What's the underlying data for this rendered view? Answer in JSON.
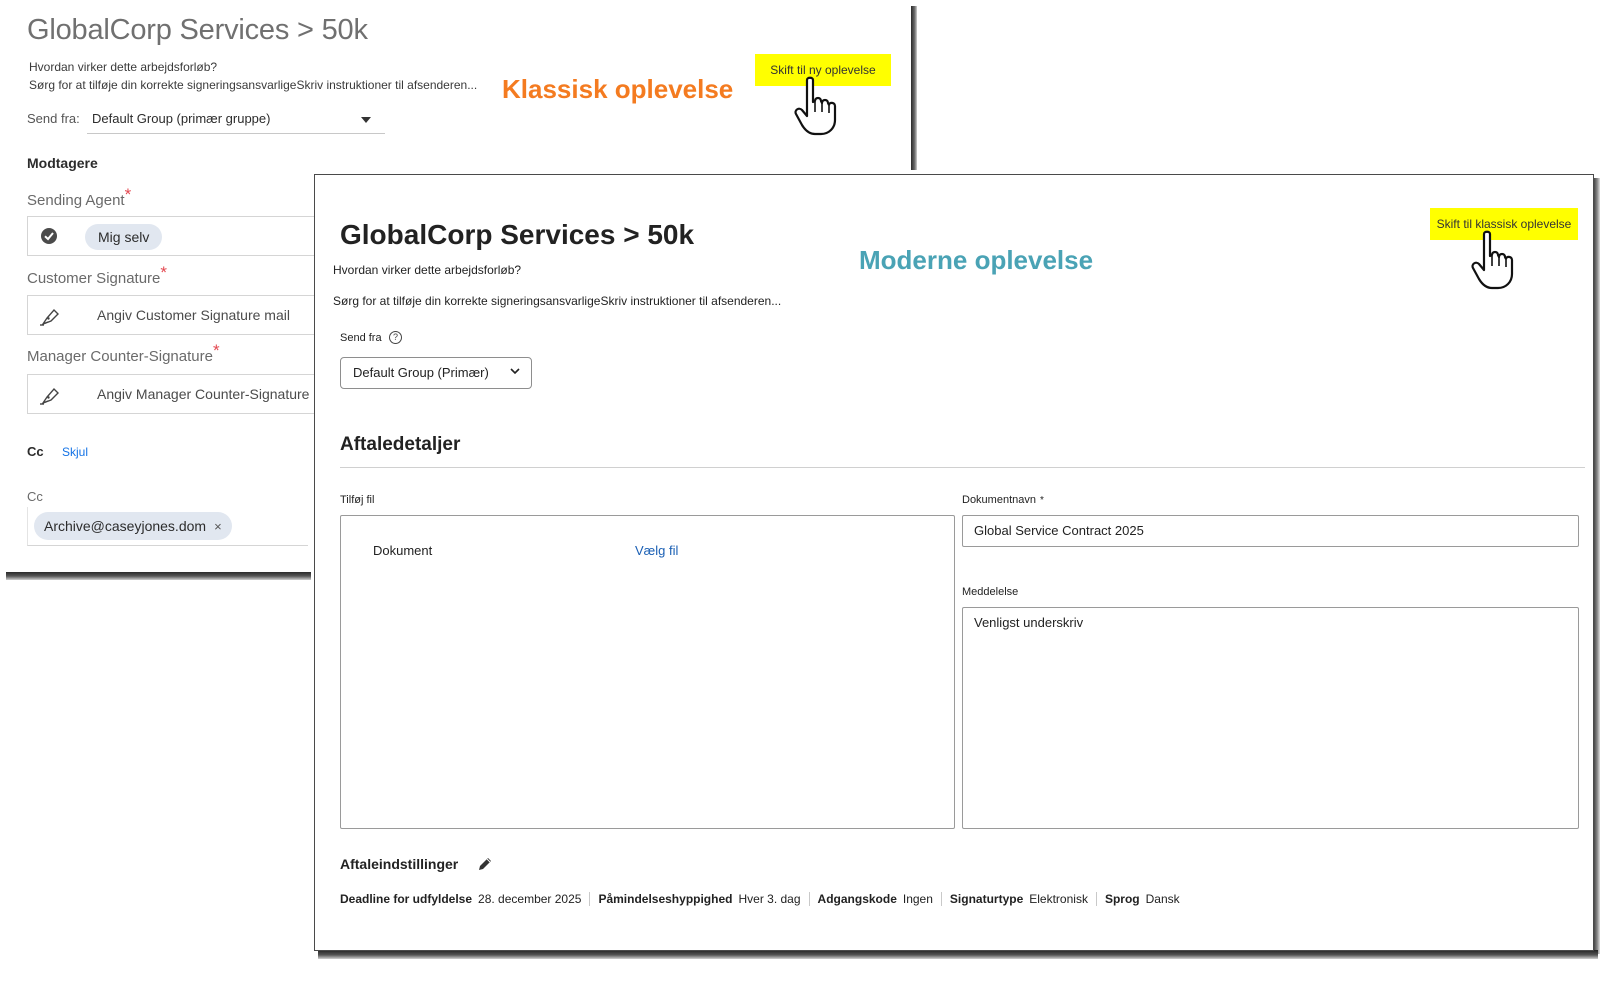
{
  "classic": {
    "title": "GlobalCorp Services > 50k",
    "how_it_works": "Hvordan virker dette arbejdsforløb?",
    "instructions": "Sørg for at tilføje din korrekte signeringsansvarligeSkriv instruktioner til afsenderen...",
    "send_from_label": "Send fra:",
    "send_from_value": "Default Group (primær gruppe)",
    "recipients_heading": "Modtagere",
    "fields": [
      {
        "label": "Sending Agent",
        "required_mark": "*",
        "value": "Mig selv",
        "icon": "check-circle-icon"
      },
      {
        "label": "Customer Signature",
        "required_mark": "*",
        "placeholder": "Angiv Customer Signature mail",
        "icon": "pen-icon"
      },
      {
        "label": "Manager Counter-Signature",
        "required_mark": "*",
        "placeholder": "Angiv Manager Counter-Signature",
        "icon": "pen-icon"
      }
    ],
    "cc_heading": "Cc",
    "cc_toggle": "Skjul",
    "cc_label": "Cc",
    "cc_chip": "Archive@caseyjones.dom",
    "cc_chip_remove": "×",
    "experience_label": "Klassisk oplevelse",
    "experience_label_color": "#f47b20",
    "switch_button": "Skift til ny oplevelse"
  },
  "modern": {
    "title": "GlobalCorp Services > 50k",
    "how_it_works": "Hvordan virker dette arbejdsforløb?",
    "instructions": "Sørg for at tilføje din korrekte signeringsansvarligeSkriv instruktioner til afsenderen...",
    "send_from_label": "Send fra",
    "send_from_help": "?",
    "send_from_value": "Default Group (Primær)",
    "section_title": "Aftaledetaljer",
    "add_file_label": "Tilføj fil",
    "file_row_name": "Dokument",
    "file_row_action": "Vælg fil",
    "doc_name_label": "Dokumentnavn",
    "doc_name_required": "*",
    "doc_name_value": "Global Service Contract 2025",
    "message_label": "Meddelelse",
    "message_value": "Venligst underskriv",
    "settings_heading": "Aftaleindstillinger",
    "settings": [
      {
        "key": "Deadline for udfyldelse",
        "value": "28. december 2025"
      },
      {
        "key": "Påmindelseshyppighed",
        "value": "Hver 3. dag"
      },
      {
        "key": "Adgangskode",
        "value": "Ingen"
      },
      {
        "key": "Signaturtype",
        "value": "Elektronisk"
      },
      {
        "key": "Sprog",
        "value": "Dansk"
      }
    ],
    "experience_label": "Moderne oplevelse",
    "experience_label_color": "#4aa3b5",
    "switch_button": "Skift til klassisk oplevelse"
  },
  "highlight_color": "#ffff00"
}
